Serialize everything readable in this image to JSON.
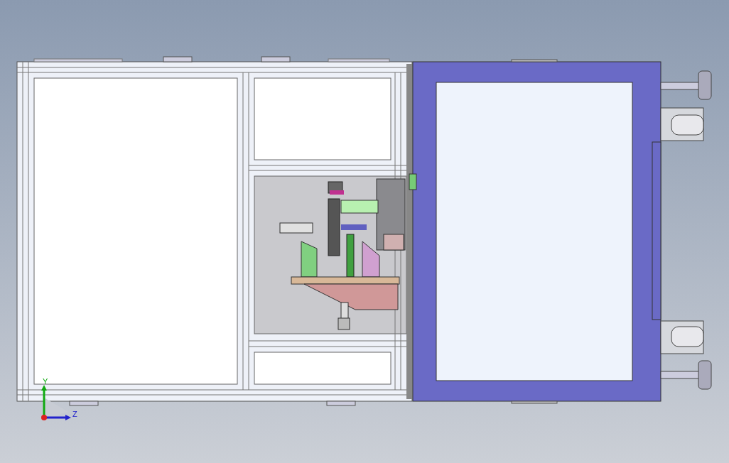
{
  "triad": {
    "labels": [
      "Y",
      "Z"
    ]
  }
}
